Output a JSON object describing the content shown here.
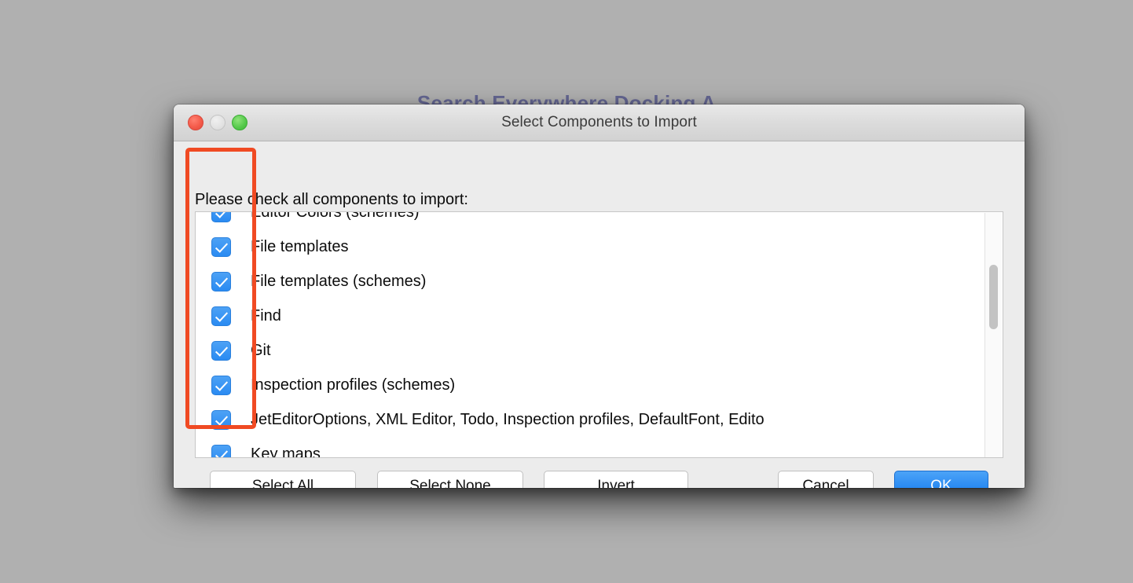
{
  "background": {
    "page_color": "#b0b0b0",
    "obscured_window_title": "Search Everywhere Docking A"
  },
  "dialog": {
    "title": "Select Components to Import",
    "traffic_lights": [
      {
        "name": "close-button",
        "color": "#f45b4a"
      },
      {
        "name": "minimize-button",
        "color": "#e2e2e2"
      },
      {
        "name": "maximize-button",
        "color": "#55c94b"
      }
    ],
    "prompt": "Please check all components to import:",
    "list": {
      "checkbox_accent": "#2a8bf2",
      "items": [
        {
          "label": "Editor Colors (schemes)",
          "checked": true
        },
        {
          "label": "File templates",
          "checked": true
        },
        {
          "label": "File templates (schemes)",
          "checked": true
        },
        {
          "label": "Find",
          "checked": true
        },
        {
          "label": "Git",
          "checked": true
        },
        {
          "label": "Inspection profiles (schemes)",
          "checked": true
        },
        {
          "label": "JetEditorOptions, XML Editor, Todo, Inspection profiles, DefaultFont, Edito",
          "checked": true
        },
        {
          "label": "Key maps",
          "checked": true
        }
      ]
    },
    "buttons": {
      "select_all": "Select All",
      "select_none": "Select None",
      "invert": "Invert",
      "cancel": "Cancel",
      "ok": "OK",
      "ok_color": "#2b8cf3"
    }
  },
  "annotation": {
    "name": "checkbox-column-highlight",
    "color": "#f04a23"
  }
}
